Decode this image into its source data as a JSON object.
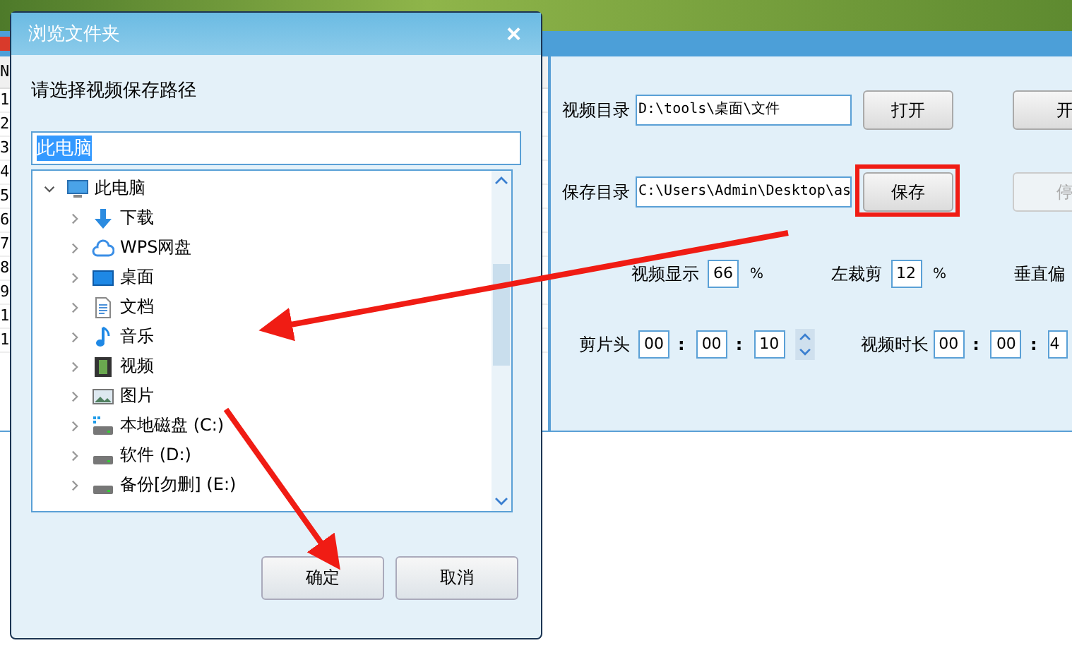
{
  "main_window": {
    "list": {
      "header": "N",
      "rows": [
        "1",
        "2",
        "3",
        "4",
        "5",
        "6",
        "7",
        "8",
        "9",
        "1",
        "1"
      ]
    },
    "video_dir": {
      "label": "视频目录",
      "value": "D:\\tools\\桌面\\文件"
    },
    "open_button": {
      "label": "打开",
      "disabled": false
    },
    "start_button": {
      "label": "开",
      "disabled": false
    },
    "save_dir": {
      "label": "保存目录",
      "value": "C:\\Users\\Admin\\Desktop\\as"
    },
    "save_button": {
      "label": "保存",
      "disabled": false
    },
    "stop_button": {
      "label": "停",
      "disabled": true
    },
    "display": {
      "label": "视频显示",
      "value": "66",
      "unit": "%"
    },
    "crop_left": {
      "label": "左裁剪",
      "value": "12",
      "unit": "%"
    },
    "vertical_offset": {
      "label": "垂直偏"
    },
    "clip_head": {
      "label": "剪片头",
      "parts": [
        "00",
        "00",
        "10"
      ],
      "separator": ":"
    },
    "duration": {
      "label": "视频时长",
      "parts": [
        "00",
        "00",
        "4"
      ],
      "separator": ":"
    }
  },
  "dialog": {
    "title": "浏览文件夹",
    "close": "×",
    "prompt": "请选择视频保存路径",
    "path": "此电脑",
    "tree": [
      {
        "label": "此电脑",
        "kind": "computer",
        "expanded": true,
        "children": [
          {
            "label": "下载",
            "kind": "download",
            "expanded": false
          },
          {
            "label": "WPS网盘",
            "kind": "cloud",
            "expanded": false
          },
          {
            "label": "桌面",
            "kind": "desktop",
            "expanded": false
          },
          {
            "label": "文档",
            "kind": "document",
            "expanded": false
          },
          {
            "label": "音乐",
            "kind": "music",
            "expanded": false
          },
          {
            "label": "视频",
            "kind": "video",
            "expanded": false
          },
          {
            "label": "图片",
            "kind": "picture",
            "expanded": false
          },
          {
            "label": "本地磁盘 (C:)",
            "kind": "system-drive",
            "expanded": false
          },
          {
            "label": "软件 (D:)",
            "kind": "drive",
            "expanded": false
          },
          {
            "label": "备份[勿删] (E:)",
            "kind": "drive",
            "expanded": false
          }
        ]
      }
    ],
    "buttons": [
      "确定",
      "取消"
    ]
  }
}
